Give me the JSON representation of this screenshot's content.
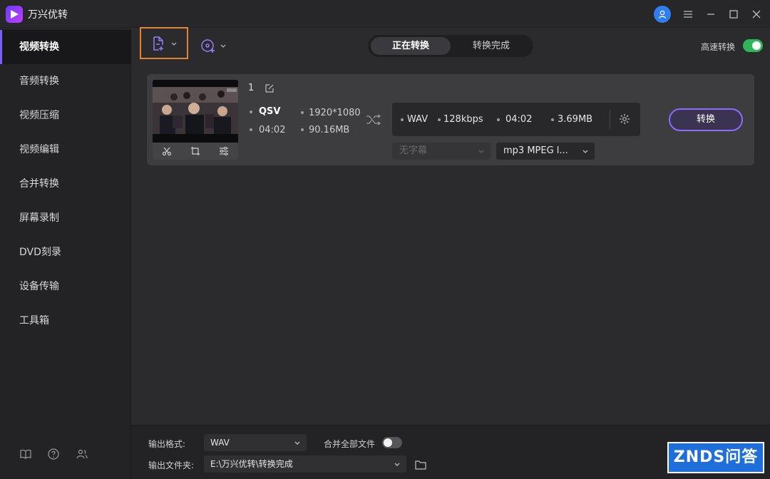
{
  "app": {
    "title": "万兴优转"
  },
  "sidebar": {
    "items": [
      {
        "label": "视频转换",
        "active": true
      },
      {
        "label": "音频转换"
      },
      {
        "label": "视频压缩"
      },
      {
        "label": "视频编辑"
      },
      {
        "label": "合并转换"
      },
      {
        "label": "屏幕录制"
      },
      {
        "label": "DVD刻录"
      },
      {
        "label": "设备传输"
      },
      {
        "label": "工具箱"
      }
    ]
  },
  "toolbar": {
    "tabs": [
      {
        "label": "正在转换",
        "active": true
      },
      {
        "label": "转换完成"
      }
    ],
    "high_speed_label": "高速转换",
    "high_speed_on": true
  },
  "file": {
    "index": "1",
    "source_format": "QSV",
    "source_resolution": "1920*1080",
    "source_duration": "04:02",
    "source_size": "90.16MB",
    "output_format": "WAV",
    "output_bitrate": "128kbps",
    "output_duration": "04:02",
    "output_size": "3.69MB",
    "subtitle_select": "无字幕",
    "audio_select": "mp3 MPEG l...",
    "convert_label": "转换"
  },
  "bottom": {
    "output_format_label": "输出格式:",
    "output_format_value": "WAV",
    "merge_label": "合并全部文件",
    "merge_on": false,
    "output_folder_label": "输出文件夹:",
    "output_folder_value": "E:\\万兴优转\\转换完成"
  },
  "watermark": {
    "text": "ZNDS问答"
  },
  "colors": {
    "accent": "#7a5cff",
    "toggle_on": "#2fb55a",
    "highlight": "#e5822e",
    "user": "#2f7ef0"
  }
}
